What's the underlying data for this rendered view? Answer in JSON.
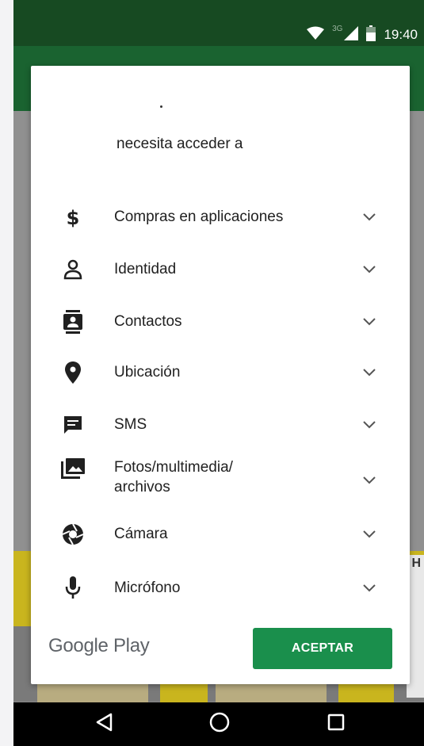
{
  "status_bar": {
    "time": "19:40",
    "network_label": "3G",
    "icons": [
      "wifi-icon",
      "cell-signal-icon",
      "battery-icon"
    ]
  },
  "dialog": {
    "app_name": ".",
    "subtitle": "necesita acceder a",
    "permissions": [
      {
        "label": "Compras en aplicaciones",
        "icon": "dollar-icon"
      },
      {
        "label": "Identidad",
        "icon": "person-icon"
      },
      {
        "label": "Contactos",
        "icon": "contacts-icon"
      },
      {
        "label": "Ubicación",
        "icon": "location-pin-icon"
      },
      {
        "label": "SMS",
        "icon": "sms-icon"
      },
      {
        "label": "Fotos/multimedia/",
        "label_line2": "archivos",
        "icon": "photos-icon"
      },
      {
        "label": "Cámara",
        "icon": "camera-icon"
      },
      {
        "label": "Micrófono",
        "icon": "microphone-icon"
      }
    ],
    "brand": "Google Play",
    "accept_label": "ACEPTAR"
  },
  "behind": {
    "corner_letter": "H"
  },
  "nav_bar": {
    "icons": [
      "back-icon",
      "home-icon",
      "recents-icon"
    ]
  },
  "colors": {
    "status_bar": "#174a22",
    "app_bar": "#1a6330",
    "accent": "#1a8f4c",
    "nav_bar": "#000000"
  }
}
